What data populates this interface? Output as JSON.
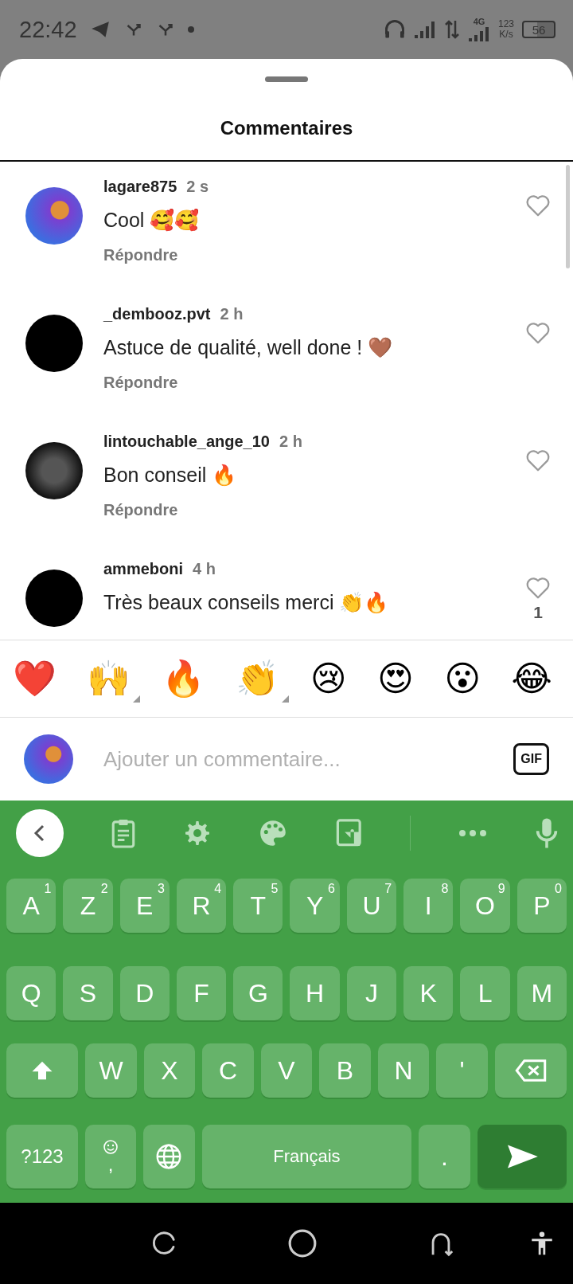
{
  "status_bar": {
    "time": "22:42",
    "network_type": "4G",
    "speed": "123",
    "speed_unit": "K/s",
    "battery": "56"
  },
  "sheet": {
    "title": "Commentaires"
  },
  "comments": [
    {
      "username": "lagare875",
      "time": "2 s",
      "text": "Cool 🥰🥰",
      "reply": "Répondre"
    },
    {
      "username": "_dembooz.pvt",
      "time": "2 h",
      "text": "Astuce de qualité, well done ! 🤎",
      "reply": "Répondre"
    },
    {
      "username": "lintouchable_ange_10",
      "time": "2 h",
      "text": "Bon conseil 🔥",
      "reply": "Répondre"
    },
    {
      "username": "ammeboni",
      "time": "4 h",
      "text": "Très beaux conseils merci 👏🔥",
      "likes": "1"
    }
  ],
  "reactions": [
    {
      "emoji": "❤️",
      "variants": false
    },
    {
      "emoji": "🙌",
      "variants": true
    },
    {
      "emoji": "🔥",
      "variants": false
    },
    {
      "emoji": "👏",
      "variants": true
    },
    {
      "emoji": "😢",
      "variants": false
    },
    {
      "emoji": "😍",
      "variants": false
    },
    {
      "emoji": "😮",
      "variants": false
    },
    {
      "emoji": "😂",
      "variants": false
    }
  ],
  "comment_input": {
    "placeholder": "Ajouter un commentaire...",
    "gif_label": "GIF"
  },
  "keyboard": {
    "rows": [
      {
        "keys": [
          {
            "kind": "letter",
            "label": "A",
            "hint": "1"
          },
          {
            "kind": "letter",
            "label": "Z",
            "hint": "2"
          },
          {
            "kind": "letter",
            "label": "E",
            "hint": "3"
          },
          {
            "kind": "letter",
            "label": "R",
            "hint": "4"
          },
          {
            "kind": "letter",
            "label": "T",
            "hint": "5"
          },
          {
            "kind": "letter",
            "label": "Y",
            "hint": "6"
          },
          {
            "kind": "letter",
            "label": "U",
            "hint": "7"
          },
          {
            "kind": "letter",
            "label": "I",
            "hint": "8"
          },
          {
            "kind": "letter",
            "label": "O",
            "hint": "9"
          },
          {
            "kind": "letter",
            "label": "P",
            "hint": "0"
          }
        ]
      },
      {
        "keys": [
          {
            "kind": "letter",
            "label": "Q"
          },
          {
            "kind": "letter",
            "label": "S"
          },
          {
            "kind": "letter",
            "label": "D"
          },
          {
            "kind": "letter",
            "label": "F"
          },
          {
            "kind": "letter",
            "label": "G"
          },
          {
            "kind": "letter",
            "label": "H"
          },
          {
            "kind": "letter",
            "label": "J"
          },
          {
            "kind": "letter",
            "label": "K"
          },
          {
            "kind": "letter",
            "label": "L"
          },
          {
            "kind": "letter",
            "label": "M"
          }
        ]
      },
      {
        "keys": [
          {
            "kind": "shift"
          },
          {
            "kind": "letter",
            "label": "W"
          },
          {
            "kind": "letter",
            "label": "X"
          },
          {
            "kind": "letter",
            "label": "C"
          },
          {
            "kind": "letter",
            "label": "V"
          },
          {
            "kind": "letter",
            "label": "B"
          },
          {
            "kind": "letter",
            "label": "N"
          },
          {
            "kind": "letter",
            "label": "'"
          },
          {
            "kind": "backspace"
          }
        ]
      },
      {
        "keys": [
          {
            "kind": "symbols",
            "label": "?123"
          },
          {
            "kind": "emoji",
            "label": ","
          },
          {
            "kind": "globe"
          },
          {
            "kind": "space",
            "label": "Français"
          },
          {
            "kind": "letter",
            "label": "."
          },
          {
            "kind": "send"
          }
        ]
      }
    ]
  }
}
